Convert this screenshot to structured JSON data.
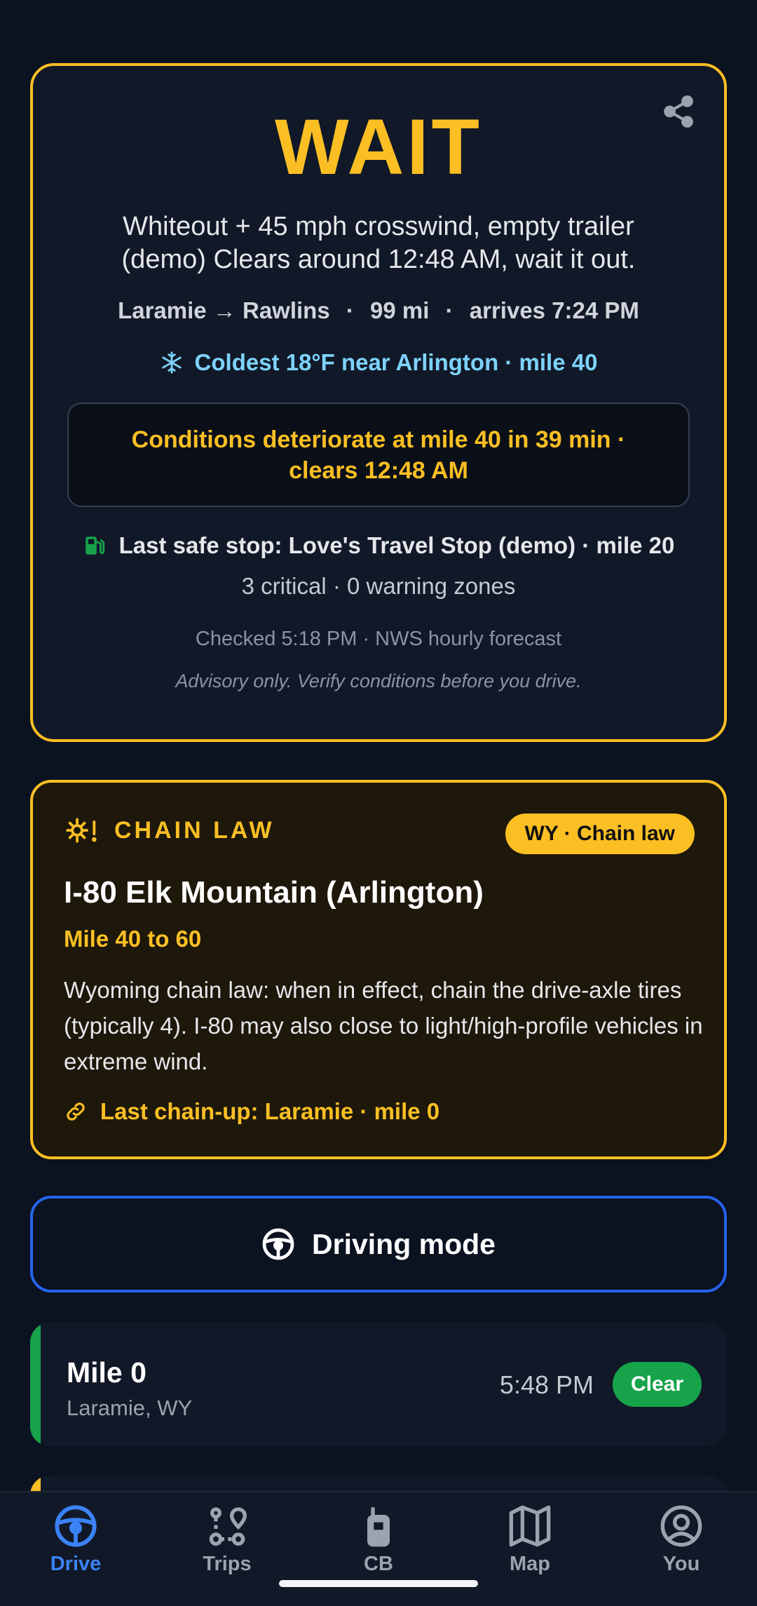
{
  "status": {
    "verdict": "WAIT",
    "reason": "Whiteout + 45 mph crosswind, empty trailer (demo) Clears around 12:48 AM, wait it out.",
    "route": {
      "from": "Laramie",
      "arrow": "→",
      "to": "Rawlins",
      "distance": "99 mi",
      "arrival": "arrives 7:24 PM"
    },
    "coldest": "Coldest 18°F near Arlington · mile 40",
    "deteriorate": "Conditions deteriorate at mile 40 in 39 min · clears 12:48 AM",
    "last_stop": "Last safe stop: Love's Travel Stop (demo) · mile 20",
    "zones": "3 critical · 0 warning zones",
    "checked": "Checked 5:18 PM · NWS hourly forecast",
    "advisory": "Advisory only. Verify conditions before you drive."
  },
  "chain": {
    "label": "CHAIN LAW",
    "badge": "WY · Chain law",
    "title": "I-80 Elk Mountain (Arlington)",
    "miles": "Mile 40 to 60",
    "description": "Wyoming chain law: when in effect, chain the drive-axle tires (typically 4). I-80 may also close to light/high-profile vehicles in extreme wind.",
    "last_chain_up": "Last chain-up: Laramie · mile 0"
  },
  "driving_mode": {
    "label": "Driving mode"
  },
  "segments": [
    {
      "mile": "Mile 0",
      "place": "Laramie, WY",
      "time": "5:48 PM",
      "status": "Clear"
    }
  ],
  "nav": [
    {
      "label": "Drive",
      "icon": "steering-wheel-icon"
    },
    {
      "label": "Trips",
      "icon": "route-icon"
    },
    {
      "label": "CB",
      "icon": "radio-icon"
    },
    {
      "label": "Map",
      "icon": "map-icon"
    },
    {
      "label": "You",
      "icon": "user-circle-icon"
    }
  ],
  "colors": {
    "accent_wait": "#fbbf24",
    "clear": "#16a34a",
    "primary": "#3b82f6",
    "cold": "#7dd3fc",
    "background": "#0b1220"
  }
}
